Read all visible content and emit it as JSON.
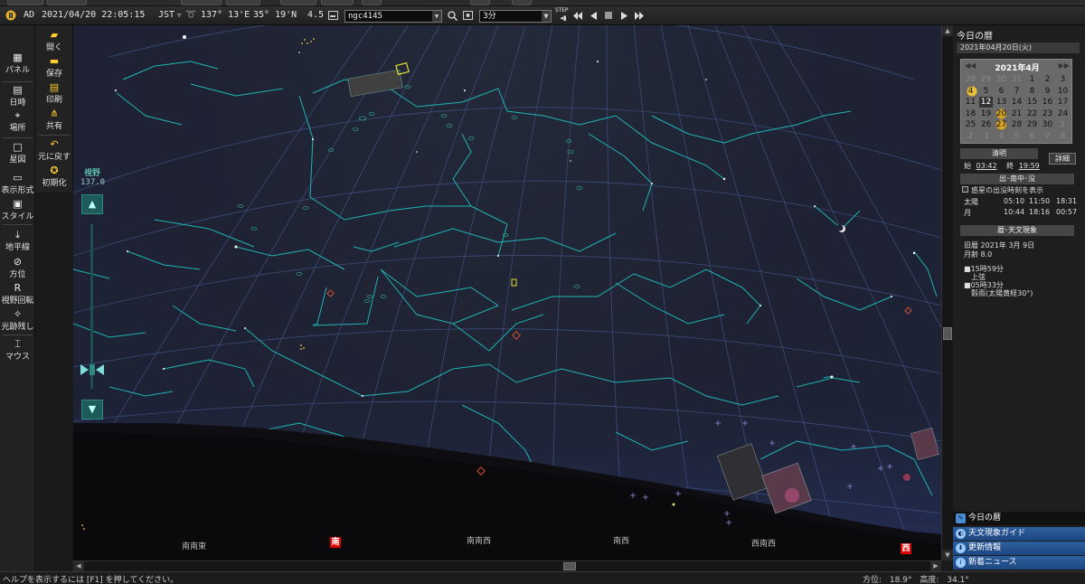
{
  "timebar": {
    "era": "AD",
    "datetime": "2021/04/20 22:05:15",
    "timezone": "JST",
    "longitude": "137° 13'E",
    "latitude": "35° 19'N",
    "magnitude": "4.5",
    "object_name": "ngc4145",
    "speed": "3分",
    "step_label": "STEP"
  },
  "toolbar_left": [
    {
      "icon": "▦",
      "label": "パネル"
    },
    {
      "icon": "▤",
      "label": "日時"
    },
    {
      "icon": "⌖",
      "label": "場所"
    },
    {
      "icon": "□",
      "label": "星図"
    },
    {
      "icon": "▭",
      "label": "表示形式"
    },
    {
      "icon": "▣",
      "label": "スタイル"
    },
    {
      "icon": "⤓",
      "label": "地平線"
    },
    {
      "icon": "⊘",
      "label": "方位"
    },
    {
      "icon": "R",
      "label": "視野回転"
    },
    {
      "icon": "✧",
      "label": "光跡残し"
    },
    {
      "icon": "⌶",
      "label": "マウス"
    }
  ],
  "toolbar_file": [
    {
      "icon": "▰",
      "label": "開く"
    },
    {
      "icon": "▬",
      "label": "保存"
    },
    {
      "icon": "▤",
      "label": "印刷"
    },
    {
      "icon": "⋔",
      "label": "共有"
    },
    {
      "icon": "↶",
      "label": "元に戻す"
    },
    {
      "icon": "✪",
      "label": "初期化"
    }
  ],
  "fov": {
    "label": "視野",
    "value": "137.0"
  },
  "directions": [
    {
      "label": "南南東",
      "major": false
    },
    {
      "label": "南",
      "major": true
    },
    {
      "label": "南南西",
      "major": false
    },
    {
      "label": "南西",
      "major": false
    },
    {
      "label": "西南西",
      "major": false
    },
    {
      "label": "西",
      "major": true
    }
  ],
  "panel": {
    "title": "今日の暦",
    "date": "2021年04月20日(火)",
    "calendar": {
      "month_label": "2021年4月",
      "rows": [
        [
          "28",
          "29",
          "30",
          "31",
          "1",
          "2",
          "3"
        ],
        [
          "4",
          "5",
          "6",
          "7",
          "8",
          "9",
          "10"
        ],
        [
          "11",
          "12",
          "13",
          "14",
          "15",
          "16",
          "17"
        ],
        [
          "18",
          "19",
          "20",
          "21",
          "22",
          "23",
          "24"
        ],
        [
          "25",
          "26",
          "27",
          "28",
          "29",
          "30",
          "1"
        ],
        [
          "2",
          "3",
          "4",
          "5",
          "6",
          "7",
          "8"
        ]
      ]
    },
    "sekki": "清明",
    "sekki_start_label": "始",
    "sekki_start": "03:42",
    "sekki_end_label": "終",
    "sekki_end": "19:59",
    "detail_button": "詳細",
    "rise_set_title": "出･南中･没",
    "planet_checkbox": "惑星の出没時刻を表示",
    "sun_label": "太陽",
    "sun_times": [
      "05:10",
      "11:50",
      "18:31"
    ],
    "moon_label": "月",
    "moon_times": [
      "10:44",
      "18:16",
      "00:57"
    ],
    "calendar_section_title": "暦･天文現象",
    "lunar_date": "旧暦 2021年 3月 9日",
    "moon_age": "月齢 8.0",
    "event1_time": "15時59分",
    "event1_label": "上弦",
    "event2_time": "05時33分",
    "event2_label": "穀雨(太陽黄経30°)",
    "links": [
      {
        "label": "今日の暦"
      },
      {
        "label": "天文現象ガイド"
      },
      {
        "label": "更新情報"
      },
      {
        "label": "新着ニュース"
      }
    ]
  },
  "status": {
    "help": "ヘルプを表示するには [F1] を押してください。",
    "azimuth_label": "方位:",
    "azimuth": "18.9°",
    "altitude_label": "高度:",
    "altitude": "34.1°"
  },
  "colors": {
    "sky": "#1e2233",
    "constellation": "#1fb4b4",
    "grid": "#3a4c7a",
    "ground": "#0e0e12",
    "accent": "#d00000"
  }
}
